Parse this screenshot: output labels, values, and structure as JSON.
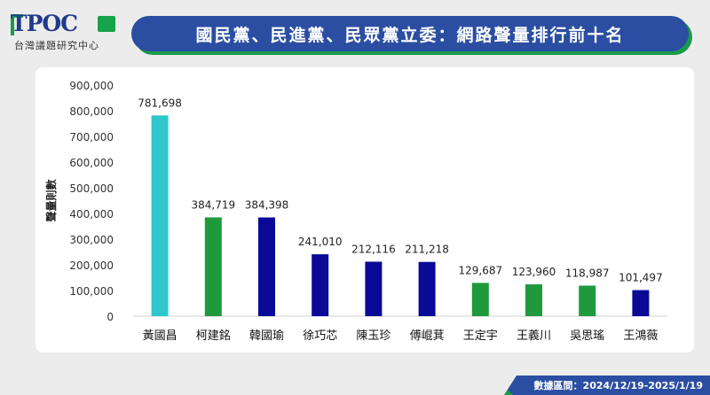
{
  "logo": {
    "name": "TPOC",
    "subtitle": "台灣議題研究中心"
  },
  "title": "國民黨、民進黨、民眾黨立委：網路聲量排行前十名",
  "footer": "數據區間：2024/12/19-2025/1/19",
  "colors": {
    "title_bg": "#2b4ea2",
    "title_shadow": "#1a9b49",
    "kmt": "#0a0a96",
    "dpp": "#1e9a3c",
    "tpp": "#2ec7cc"
  },
  "chart_data": {
    "type": "bar",
    "ylabel": "聲量則數",
    "ylim": [
      0,
      900000
    ],
    "yticks": [
      0,
      100000,
      200000,
      300000,
      400000,
      500000,
      600000,
      700000,
      800000,
      900000
    ],
    "ytick_labels": [
      "0",
      "100,000",
      "200,000",
      "300,000",
      "400,000",
      "500,000",
      "600,000",
      "700,000",
      "800,000",
      "900,000"
    ],
    "grid": false,
    "categories": [
      "黃國昌",
      "柯建銘",
      "韓國瑜",
      "徐巧芯",
      "陳玉珍",
      "傅崐萁",
      "王定宇",
      "王義川",
      "吳思瑤",
      "王鴻薇"
    ],
    "values": [
      781698,
      384719,
      384398,
      241010,
      212116,
      211218,
      129687,
      123960,
      118987,
      101497
    ],
    "value_labels": [
      "781,698",
      "384,719",
      "384,398",
      "241,010",
      "212,116",
      "211,218",
      "129,687",
      "123,960",
      "118,987",
      "101,497"
    ],
    "bar_colors": [
      "#2ec7cc",
      "#1e9a3c",
      "#0a0a96",
      "#0a0a96",
      "#0a0a96",
      "#0a0a96",
      "#1e9a3c",
      "#1e9a3c",
      "#1e9a3c",
      "#0a0a96"
    ]
  }
}
